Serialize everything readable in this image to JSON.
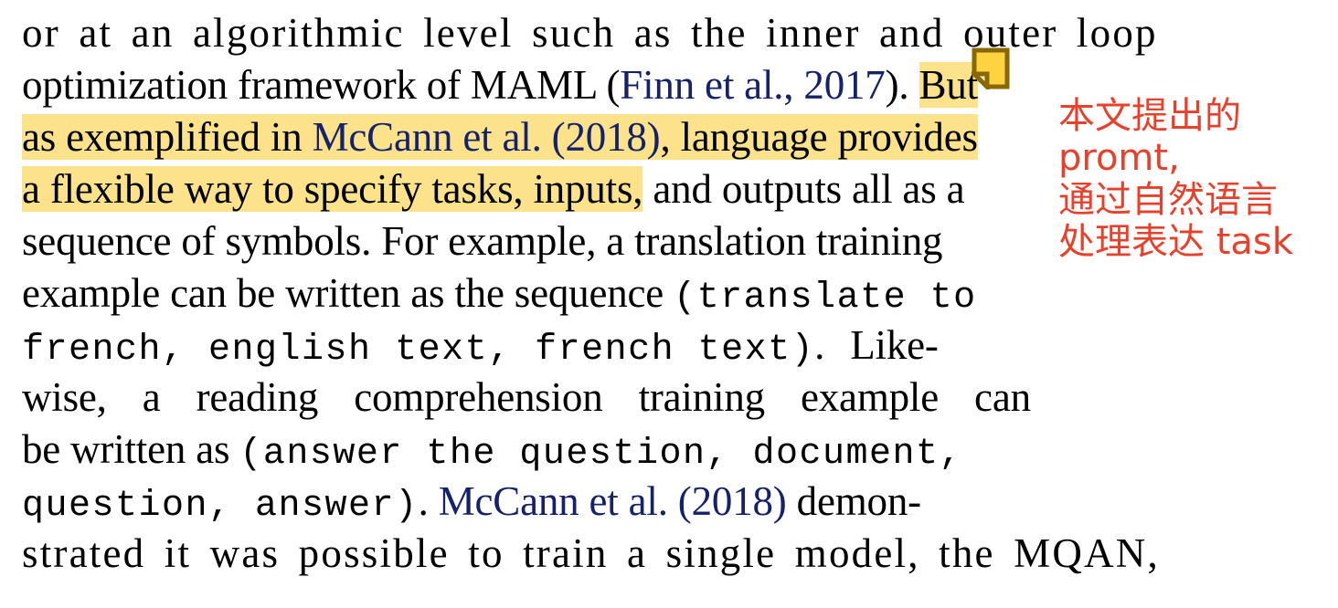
{
  "document": {
    "type": "pdf-page-excerpt",
    "background_color": "#ffffff",
    "body_text_color": "#000000",
    "citation_link_color": "#16216B",
    "highlight_color": "#FCE28B",
    "annotation_color": "#E8402A"
  },
  "body": {
    "clipped_top_fragment": "p",
    "lines": [
      {
        "id": "line-1",
        "segments": [
          {
            "text": "or at an algorithmic level such as the inner and outer loop",
            "style": "plain"
          }
        ]
      },
      {
        "id": "line-2",
        "segments": [
          {
            "text": "optimization framework of MAML (",
            "style": "plain"
          },
          {
            "text": "Finn et al., 2017",
            "style": "citation"
          },
          {
            "text": "). ",
            "style": "plain"
          },
          {
            "text": "But",
            "style": "highlight"
          }
        ]
      },
      {
        "id": "line-3",
        "segments": [
          {
            "text": "as exemplified in ",
            "style": "highlight"
          },
          {
            "text": "McCann et al. (2018)",
            "style": "highlight-citation"
          },
          {
            "text": ", language provides",
            "style": "highlight"
          }
        ]
      },
      {
        "id": "line-4",
        "segments": [
          {
            "text": "a flexible way to specify tasks, inputs,",
            "style": "highlight"
          },
          {
            "text": " and outputs all as a",
            "style": "plain"
          }
        ]
      },
      {
        "id": "line-5",
        "segments": [
          {
            "text": "sequence of symbols. For example, a translation training",
            "style": "plain"
          }
        ]
      },
      {
        "id": "line-6",
        "segments": [
          {
            "text": "example can be written as the sequence ",
            "style": "plain"
          },
          {
            "text": "(translate to",
            "style": "mono"
          }
        ]
      },
      {
        "id": "line-7",
        "segments": [
          {
            "text": "french, english text, french text)",
            "style": "mono"
          },
          {
            "text": ". Like-",
            "style": "plain"
          }
        ]
      },
      {
        "id": "line-8",
        "segments": [
          {
            "text": "wise, a reading comprehension training example can",
            "style": "plain"
          }
        ]
      },
      {
        "id": "line-9",
        "segments": [
          {
            "text": "be written as ",
            "style": "plain"
          },
          {
            "text": "(answer the question, document,",
            "style": "mono"
          }
        ]
      },
      {
        "id": "line-10",
        "segments": [
          {
            "text": "question, answer)",
            "style": "mono"
          },
          {
            "text": ". ",
            "style": "plain"
          },
          {
            "text": "McCann et al. (2018)",
            "style": "citation"
          },
          {
            "text": " demon-",
            "style": "plain"
          }
        ]
      },
      {
        "id": "line-11",
        "segments": [
          {
            "text": "strated it was possible to train a single model, the MQAN,",
            "style": "plain"
          }
        ]
      }
    ]
  },
  "annotations": {
    "sticky_note": {
      "icon": "sticky-note-icon",
      "fill_color": "#FFD23F",
      "border_color": "#8A6800"
    },
    "margin_note": {
      "color": "#E8402A",
      "lines": [
        "本文提出的",
        "promt,",
        "通过自然语言",
        "处理表达 task"
      ]
    }
  }
}
